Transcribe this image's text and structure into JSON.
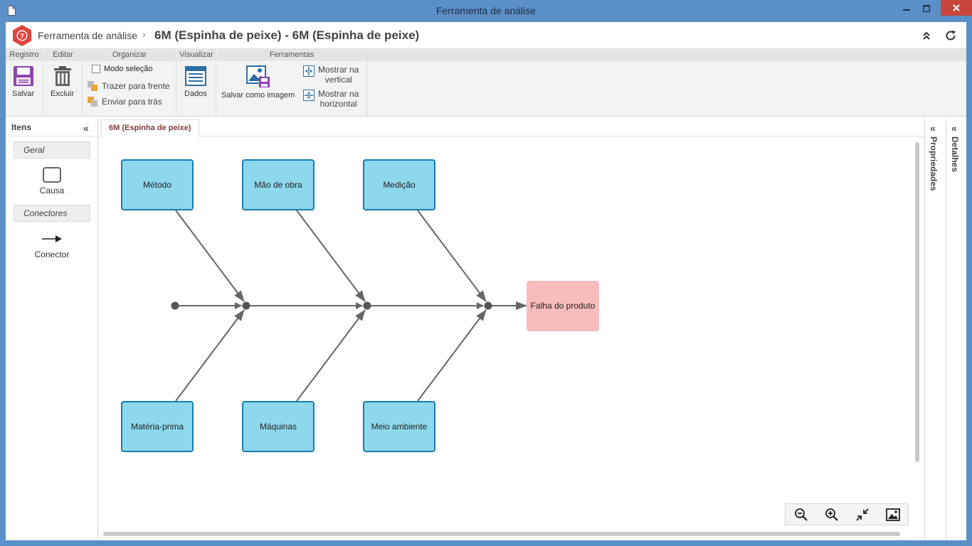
{
  "window": {
    "title": "Ferramenta de análise"
  },
  "header": {
    "app_name": "Ferramenta de análise",
    "page_title": "6M (Espinha de peixe) - 6M (Espinha de peixe)"
  },
  "ribbon": {
    "groups": {
      "registro": "Registro",
      "editar": "Editar",
      "organizar": "Organizar",
      "visualizar": "Visualizar",
      "ferramentas": "Ferramentas"
    },
    "buttons": {
      "salvar": "Salvar",
      "excluir": "Excluir",
      "modo_selecao": "Modo seleção",
      "trazer_frente": "Trazer para frente",
      "enviar_tras": "Enviar para trás",
      "dados": "Dados",
      "salvar_imagem": "Salvar como imagem",
      "mostrar_vertical_1": "Mostrar na",
      "mostrar_vertical_2": "vertical",
      "mostrar_horizontal_1": "Mostrar na",
      "mostrar_horizontal_2": "horizontal"
    },
    "modo_selecao_checked": false
  },
  "items_panel": {
    "title": "Itens",
    "sections": {
      "geral": "Geral",
      "conectores": "Conectores"
    },
    "items": {
      "causa": "Causa",
      "conector": "Conector"
    }
  },
  "canvas": {
    "tab_label": "6M (Espinha de peixe)",
    "causes_top": [
      "Método",
      "Mão de obra",
      "Medição"
    ],
    "causes_bottom": [
      "Matéria-prima",
      "Máquinas",
      "Meio ambiente"
    ],
    "effect": "Falha do produto"
  },
  "right_panels": {
    "propriedades": "Propriedades",
    "detalhes": "Detalhes"
  },
  "colors": {
    "cause_fill": "#8dd8ec",
    "cause_border": "#1a7bb3",
    "effect_fill": "#f8bcbc",
    "line": "#666666",
    "title_bar": "#5b8fc7",
    "close_button": "#c9463d",
    "logo": "#e0443c"
  }
}
